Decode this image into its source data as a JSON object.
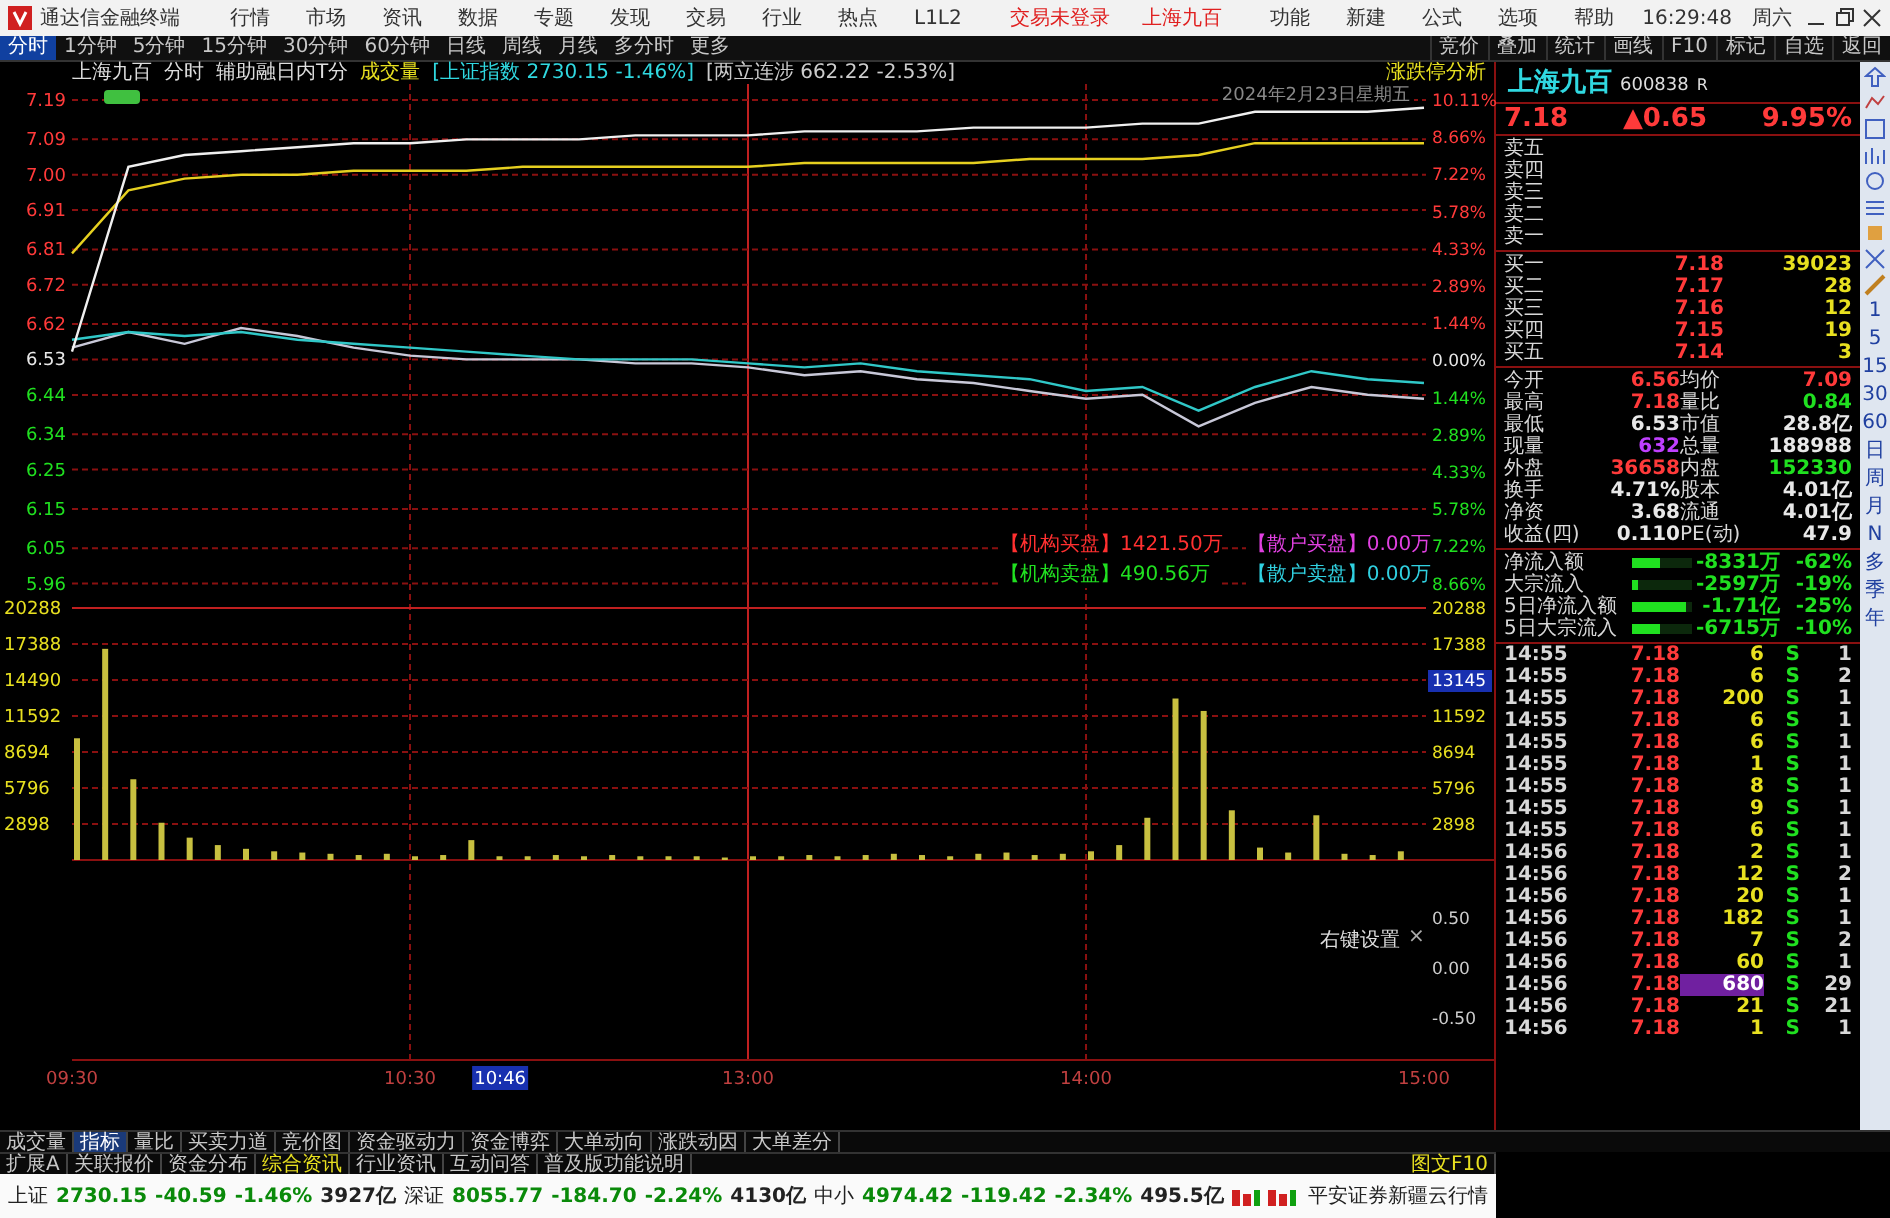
{
  "app_bar": {
    "title": "通达信金融终端",
    "menu": [
      "行情",
      "市场",
      "资讯",
      "数据",
      "专题",
      "发现",
      "交易",
      "行业",
      "热点",
      "L1L2"
    ],
    "notices": [
      "交易未登录",
      "上海九百"
    ],
    "actions": [
      "功能",
      "新建",
      "公式",
      "选项",
      "帮助"
    ],
    "clock": "16:29:48",
    "weekday": "周六"
  },
  "period_tabs": [
    {
      "label": "分时",
      "selected": true
    },
    {
      "label": "1分钟",
      "selected": false
    },
    {
      "label": "5分钟",
      "selected": false
    },
    {
      "label": "15分钟",
      "selected": false
    },
    {
      "label": "30分钟",
      "selected": false
    },
    {
      "label": "60分钟",
      "selected": false
    },
    {
      "label": "日线",
      "selected": false
    },
    {
      "label": "周线",
      "selected": false
    },
    {
      "label": "月线",
      "selected": false
    },
    {
      "label": "多分时",
      "selected": false
    },
    {
      "label": "更多",
      "selected": false
    }
  ],
  "tools": [
    "竞价",
    "叠加",
    "统计",
    "画线",
    "F10",
    "标记",
    "自选",
    "返回"
  ],
  "chart": {
    "stock": "上海九百",
    "mode": "分时",
    "indicator": "辅助融日内T分",
    "volume_label": "成交量",
    "overlays": [
      "[上证指数 2730.15 -1.46%]",
      "[两立连涉 662.22 -2.53%]"
    ],
    "analysis_link": "涨跌停分析",
    "date": "2024年2月23日星期五",
    "price_chart": {
      "chart_data": {
        "type": "line",
        "grid": true,
        "ylim": [
          5.96,
          7.19
        ],
        "yticks": [
          {
            "value": 7.19,
            "label": "7.19"
          },
          {
            "value": 7.09,
            "label": "7.09"
          },
          {
            "value": 7.0,
            "label": "7.00"
          },
          {
            "value": 6.91,
            "label": "6.91"
          },
          {
            "value": 6.81,
            "label": "6.81"
          },
          {
            "value": 6.72,
            "label": "6.72"
          },
          {
            "value": 6.62,
            "label": "6.62"
          },
          {
            "value": 6.53,
            "label": "6.53"
          },
          {
            "value": 6.44,
            "label": "6.44"
          },
          {
            "value": 6.34,
            "label": "6.34"
          },
          {
            "value": 6.25,
            "label": "6.25"
          },
          {
            "value": 6.15,
            "label": "6.15"
          },
          {
            "value": 6.05,
            "label": "6.05"
          },
          {
            "value": 5.96,
            "label": "5.96"
          }
        ],
        "series": [
          {
            "color": "#c8c8d8",
            "values": [
              6.56,
              6.6,
              6.57,
              6.61,
              6.59,
              6.56,
              6.54,
              6.53,
              6.53,
              6.53,
              6.52,
              6.52,
              6.51,
              6.49,
              6.5,
              6.48,
              6.47,
              6.45,
              6.43,
              6.44,
              6.36,
              6.42,
              6.46,
              6.44,
              6.43
            ]
          },
          {
            "color": "#30c8c8",
            "values": [
              6.58,
              6.6,
              6.59,
              6.6,
              6.58,
              6.57,
              6.56,
              6.55,
              6.54,
              6.53,
              6.53,
              6.53,
              6.52,
              6.51,
              6.52,
              6.5,
              6.49,
              6.48,
              6.45,
              6.46,
              6.4,
              6.46,
              6.5,
              6.48,
              6.47
            ]
          },
          {
            "color": "#e6d020",
            "values": [
              6.8,
              6.96,
              6.99,
              7.0,
              7.0,
              7.01,
              7.01,
              7.01,
              7.02,
              7.02,
              7.02,
              7.02,
              7.02,
              7.03,
              7.03,
              7.03,
              7.03,
              7.04,
              7.04,
              7.04,
              7.05,
              7.08,
              7.08,
              7.08,
              7.08
            ]
          },
          {
            "color": "#f0f0f0",
            "values": [
              6.55,
              7.02,
              7.05,
              7.06,
              7.07,
              7.08,
              7.08,
              7.09,
              7.09,
              7.09,
              7.1,
              7.1,
              7.1,
              7.11,
              7.11,
              7.11,
              7.12,
              7.12,
              7.12,
              7.13,
              7.13,
              7.16,
              7.16,
              7.16,
              7.17
            ]
          }
        ]
      }
    },
    "percent_ticks": [
      "10.11%",
      "8.66%",
      "7.22%",
      "5.78%",
      "4.33%",
      "2.89%",
      "1.44%",
      "0.00%",
      "1.44%",
      "2.89%",
      "4.33%",
      "5.78%",
      "7.22%",
      "8.66%"
    ],
    "volume_chart": {
      "chart_data": {
        "type": "bar",
        "grid": true,
        "ylim": [
          0,
          20288
        ],
        "values": [
          9800,
          17000,
          6500,
          3000,
          1800,
          1200,
          900,
          700,
          600,
          500,
          400,
          500,
          300,
          400,
          1600,
          300,
          300,
          400,
          300,
          400,
          300,
          300,
          300,
          200,
          300,
          300,
          400,
          300,
          400,
          500,
          400,
          300,
          500,
          600,
          400,
          500,
          700,
          1200,
          3400,
          13000,
          12000,
          4000,
          1000,
          600,
          3600,
          500,
          400,
          700
        ],
        "yticks": [
          {
            "value": 20288,
            "label": "20288"
          },
          {
            "value": 17388,
            "label": "17388"
          },
          {
            "value": 14490,
            "label": "14490"
          },
          {
            "value": 11592,
            "label": "11592"
          },
          {
            "value": 8694,
            "label": "8694"
          },
          {
            "value": 5796,
            "label": "5796"
          },
          {
            "value": 2898,
            "label": "2898"
          }
        ]
      }
    },
    "volume_right": [
      {
        "text": "20288",
        "cursor": false
      },
      {
        "text": "17388",
        "cursor": false
      },
      {
        "text": "13145",
        "cursor": true
      },
      {
        "text": "11592",
        "cursor": false
      },
      {
        "text": "8694",
        "cursor": false
      },
      {
        "text": "5796",
        "cursor": false
      },
      {
        "text": "2898",
        "cursor": false
      }
    ],
    "flows": [
      {
        "label": "【机构买盘】",
        "value": "1421.50万",
        "color": "#ff3030"
      },
      {
        "label": "【散户买盘】",
        "value": "0.00万",
        "color": "#e040e0"
      },
      {
        "label": "【机构卖盘】",
        "value": "490.56万",
        "color": "#20e020"
      },
      {
        "label": "【散户卖盘】",
        "value": "0.00万",
        "color": "#30d0e0"
      }
    ],
    "indicator_ticks": [
      "0.50",
      "0.00",
      "-0.50"
    ],
    "settings_hint": "右键设置",
    "close_mark": "×",
    "time_ticks": [
      "09:30",
      "10:30",
      "13:00",
      "14:00",
      "15:00"
    ],
    "cursor_time": "10:46"
  },
  "quote": {
    "name": "上海九百",
    "code": "600838",
    "flag": "R",
    "price": "7.18",
    "change": "▲0.65",
    "pct": "9.95%"
  },
  "sells": [
    {
      "label": "卖五"
    },
    {
      "label": "卖四"
    },
    {
      "label": "卖三"
    },
    {
      "label": "卖二"
    },
    {
      "label": "卖一"
    }
  ],
  "buys": [
    {
      "label": "买一",
      "price": "7.18",
      "volume": "39023"
    },
    {
      "label": "买二",
      "price": "7.17",
      "volume": "28"
    },
    {
      "label": "买三",
      "price": "7.16",
      "volume": "12"
    },
    {
      "label": "买四",
      "price": "7.15",
      "volume": "19"
    },
    {
      "label": "买五",
      "price": "7.14",
      "volume": "3"
    }
  ],
  "stats": [
    [
      {
        "label": "今开",
        "value": "6.56",
        "color": "#ff3a3a"
      },
      {
        "label": "均价",
        "value": "7.09",
        "color": "#ff3a3a"
      }
    ],
    [
      {
        "label": "最高",
        "value": "7.18",
        "color": "#ff3a3a"
      },
      {
        "label": "量比",
        "value": "0.84",
        "color": "#20e020"
      }
    ],
    [
      {
        "label": "最低",
        "value": "6.53",
        "color": "#e8e8e8"
      },
      {
        "label": "市值",
        "value": "28.8亿",
        "color": "#e8e8e8"
      }
    ],
    [
      {
        "label": "现量",
        "value": "632",
        "color": "#c040ff"
      },
      {
        "label": "总量",
        "value": "188988",
        "color": "#e8e8e8"
      }
    ],
    [
      {
        "label": "外盘",
        "value": "36658",
        "color": "#ff3a3a"
      },
      {
        "label": "内盘",
        "value": "152330",
        "color": "#20e020"
      }
    ],
    [
      {
        "label": "换手",
        "value": "4.71%",
        "color": "#e8e8e8"
      },
      {
        "label": "股本",
        "value": "4.01亿",
        "color": "#e8e8e8"
      }
    ],
    [
      {
        "label": "净资",
        "value": "3.68",
        "color": "#e8e8e8"
      },
      {
        "label": "流通",
        "value": "4.01亿",
        "color": "#e8e8e8"
      }
    ],
    [
      {
        "label": "收益(四)",
        "value": "0.110",
        "color": "#e8e8e8"
      },
      {
        "label": "PE(动)",
        "value": "47.9",
        "color": "#e8e8e8"
      }
    ]
  ],
  "money_flows": [
    {
      "label": "净流入额",
      "level": 0.45,
      "value": "-8331万",
      "pct": "-62%"
    },
    {
      "label": "大宗流入",
      "level": 0.1,
      "value": "-2597万",
      "pct": "-19%"
    },
    {
      "label": "5日净流入额",
      "level": 0.9,
      "value": "-1.71亿",
      "pct": "-25%"
    },
    {
      "label": "5日大宗流入",
      "level": 0.45,
      "value": "-6715万",
      "pct": "-10%"
    }
  ],
  "trades": [
    {
      "time": "14:55",
      "price": "7.18",
      "volume": "6",
      "side": "S",
      "count": "1",
      "large": false
    },
    {
      "time": "14:55",
      "price": "7.18",
      "volume": "6",
      "side": "S",
      "count": "2",
      "large": false
    },
    {
      "time": "14:55",
      "price": "7.18",
      "volume": "200",
      "side": "S",
      "count": "1",
      "large": false
    },
    {
      "time": "14:55",
      "price": "7.18",
      "volume": "6",
      "side": "S",
      "count": "1",
      "large": false
    },
    {
      "time": "14:55",
      "price": "7.18",
      "volume": "6",
      "side": "S",
      "count": "1",
      "large": false
    },
    {
      "time": "14:55",
      "price": "7.18",
      "volume": "1",
      "side": "S",
      "count": "1",
      "large": false
    },
    {
      "time": "14:55",
      "price": "7.18",
      "volume": "8",
      "side": "S",
      "count": "1",
      "large": false
    },
    {
      "time": "14:55",
      "price": "7.18",
      "volume": "9",
      "side": "S",
      "count": "1",
      "large": false
    },
    {
      "time": "14:55",
      "price": "7.18",
      "volume": "6",
      "side": "S",
      "count": "1",
      "large": false
    },
    {
      "time": "14:56",
      "price": "7.18",
      "volume": "2",
      "side": "S",
      "count": "1",
      "large": false
    },
    {
      "time": "14:56",
      "price": "7.18",
      "volume": "12",
      "side": "S",
      "count": "2",
      "large": false
    },
    {
      "time": "14:56",
      "price": "7.18",
      "volume": "20",
      "side": "S",
      "count": "1",
      "large": false
    },
    {
      "time": "14:56",
      "price": "7.18",
      "volume": "182",
      "side": "S",
      "count": "1",
      "large": false
    },
    {
      "time": "14:56",
      "price": "7.18",
      "volume": "7",
      "side": "S",
      "count": "2",
      "large": false
    },
    {
      "time": "14:56",
      "price": "7.18",
      "volume": "60",
      "side": "S",
      "count": "1",
      "large": false
    },
    {
      "time": "14:56",
      "price": "7.18",
      "volume": "680",
      "side": "S",
      "count": "29",
      "large": true
    },
    {
      "time": "14:56",
      "price": "7.18",
      "volume": "21",
      "side": "S",
      "count": "21",
      "large": false
    },
    {
      "time": "14:56",
      "price": "7.18",
      "volume": "1",
      "side": "S",
      "count": "1",
      "large": false
    }
  ],
  "side_periods": [
    "1",
    "5",
    "15",
    "30",
    "60",
    "日",
    "周",
    "月",
    "N",
    "多",
    "季",
    "年"
  ],
  "bottom_tabs": [
    {
      "label": "成交量",
      "selected": false
    },
    {
      "label": "指标",
      "selected": true
    },
    {
      "label": "量比",
      "selected": false
    },
    {
      "label": "买卖力道",
      "selected": false
    },
    {
      "label": "竞价图",
      "selected": false
    },
    {
      "label": "资金驱动力",
      "selected": false
    },
    {
      "label": "资金博弈",
      "selected": false
    },
    {
      "label": "大单动向",
      "selected": false
    },
    {
      "label": "涨跌动因",
      "selected": false
    },
    {
      "label": "大单差分",
      "selected": false
    }
  ],
  "info_tabs": [
    {
      "label": "扩展A",
      "selected": false
    },
    {
      "label": "关联报价",
      "selected": false
    },
    {
      "label": "资金分布",
      "selected": false
    },
    {
      "label": "综合资讯",
      "selected": true
    },
    {
      "label": "行业资讯",
      "selected": false
    },
    {
      "label": "互动问答",
      "selected": false
    },
    {
      "label": "普及版功能说明",
      "selected": false
    }
  ],
  "info_link": "图文F10",
  "indices": [
    {
      "name": "上证",
      "value": "2730.15",
      "change": "-40.59",
      "pct": "-1.46%",
      "amount": "3927亿"
    },
    {
      "name": "深证",
      "value": "8055.77",
      "change": "-184.70",
      "pct": "-2.24%",
      "amount": "4130亿"
    },
    {
      "name": "中小",
      "value": "4974.42",
      "change": "-119.42",
      "pct": "-2.34%",
      "amount": "495.5亿"
    }
  ],
  "broker": "平安证券新疆云行情"
}
